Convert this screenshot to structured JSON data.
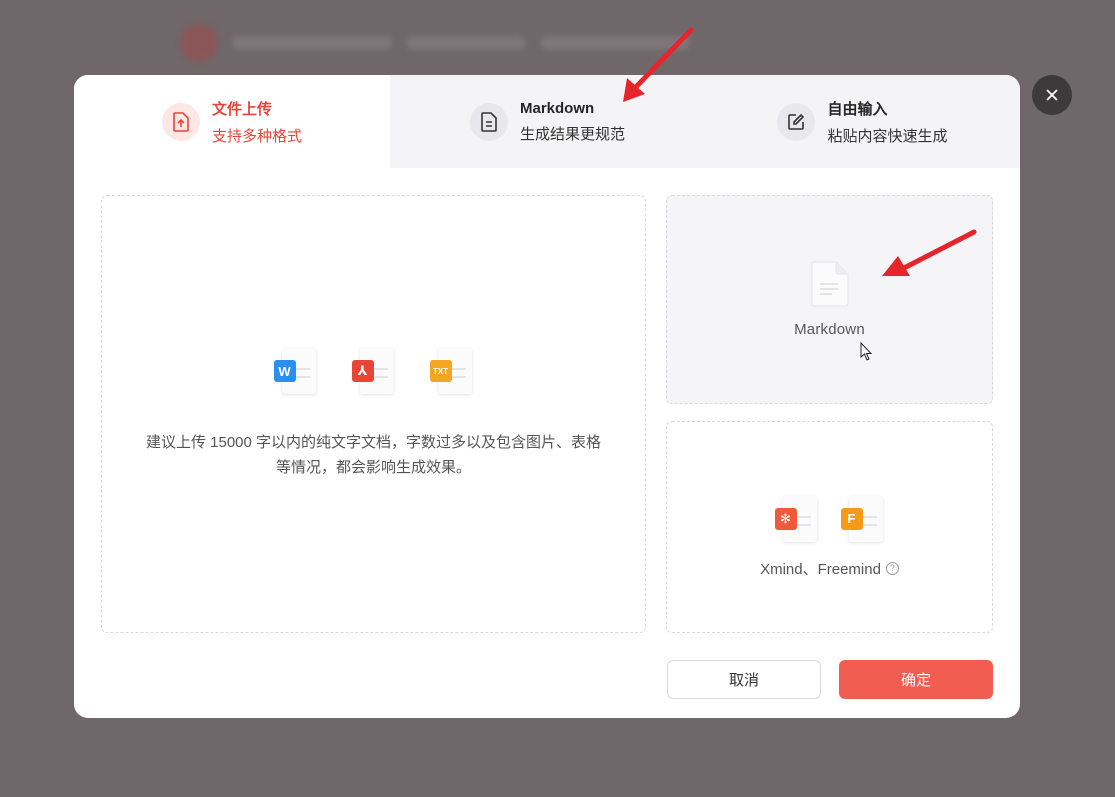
{
  "tabs": [
    {
      "title": "文件上传",
      "subtitle": "支持多种格式",
      "icon": "upload-file-icon",
      "active": true
    },
    {
      "title": "Markdown",
      "subtitle": "生成结果更规范",
      "icon": "document-icon",
      "active": false
    },
    {
      "title": "自由输入",
      "subtitle": "粘贴内容快速生成",
      "icon": "edit-icon",
      "active": false
    }
  ],
  "upload": {
    "file_types": [
      {
        "badge": "W",
        "color": "#2b8ff2",
        "icon": "word-file-icon"
      },
      {
        "badge": "⅄",
        "color": "#e8443a",
        "icon": "pdf-file-icon"
      },
      {
        "badge": "TXT",
        "color": "#f4a622",
        "icon": "txt-file-icon"
      }
    ],
    "hint_line1": "建议上传 15000 字以内的纯文字文档，字数过多以及包含图片、表格",
    "hint_line2": "等情况，都会影响生成效果。"
  },
  "markdown_card": {
    "label": "Markdown",
    "icon": "markdown-file-icon"
  },
  "mind_card": {
    "label": "Xmind、Freemind",
    "help": "?",
    "icons": [
      {
        "badge": "✻",
        "color": "#f05a3a",
        "icon": "xmind-file-icon"
      },
      {
        "badge": "F",
        "color": "#f59a17",
        "icon": "freemind-file-icon"
      }
    ]
  },
  "buttons": {
    "cancel": "取消",
    "confirm": "确定"
  },
  "colors": {
    "accent": "#f25d52",
    "active_text": "#e8443a",
    "annotation_arrow": "#e8242b"
  }
}
